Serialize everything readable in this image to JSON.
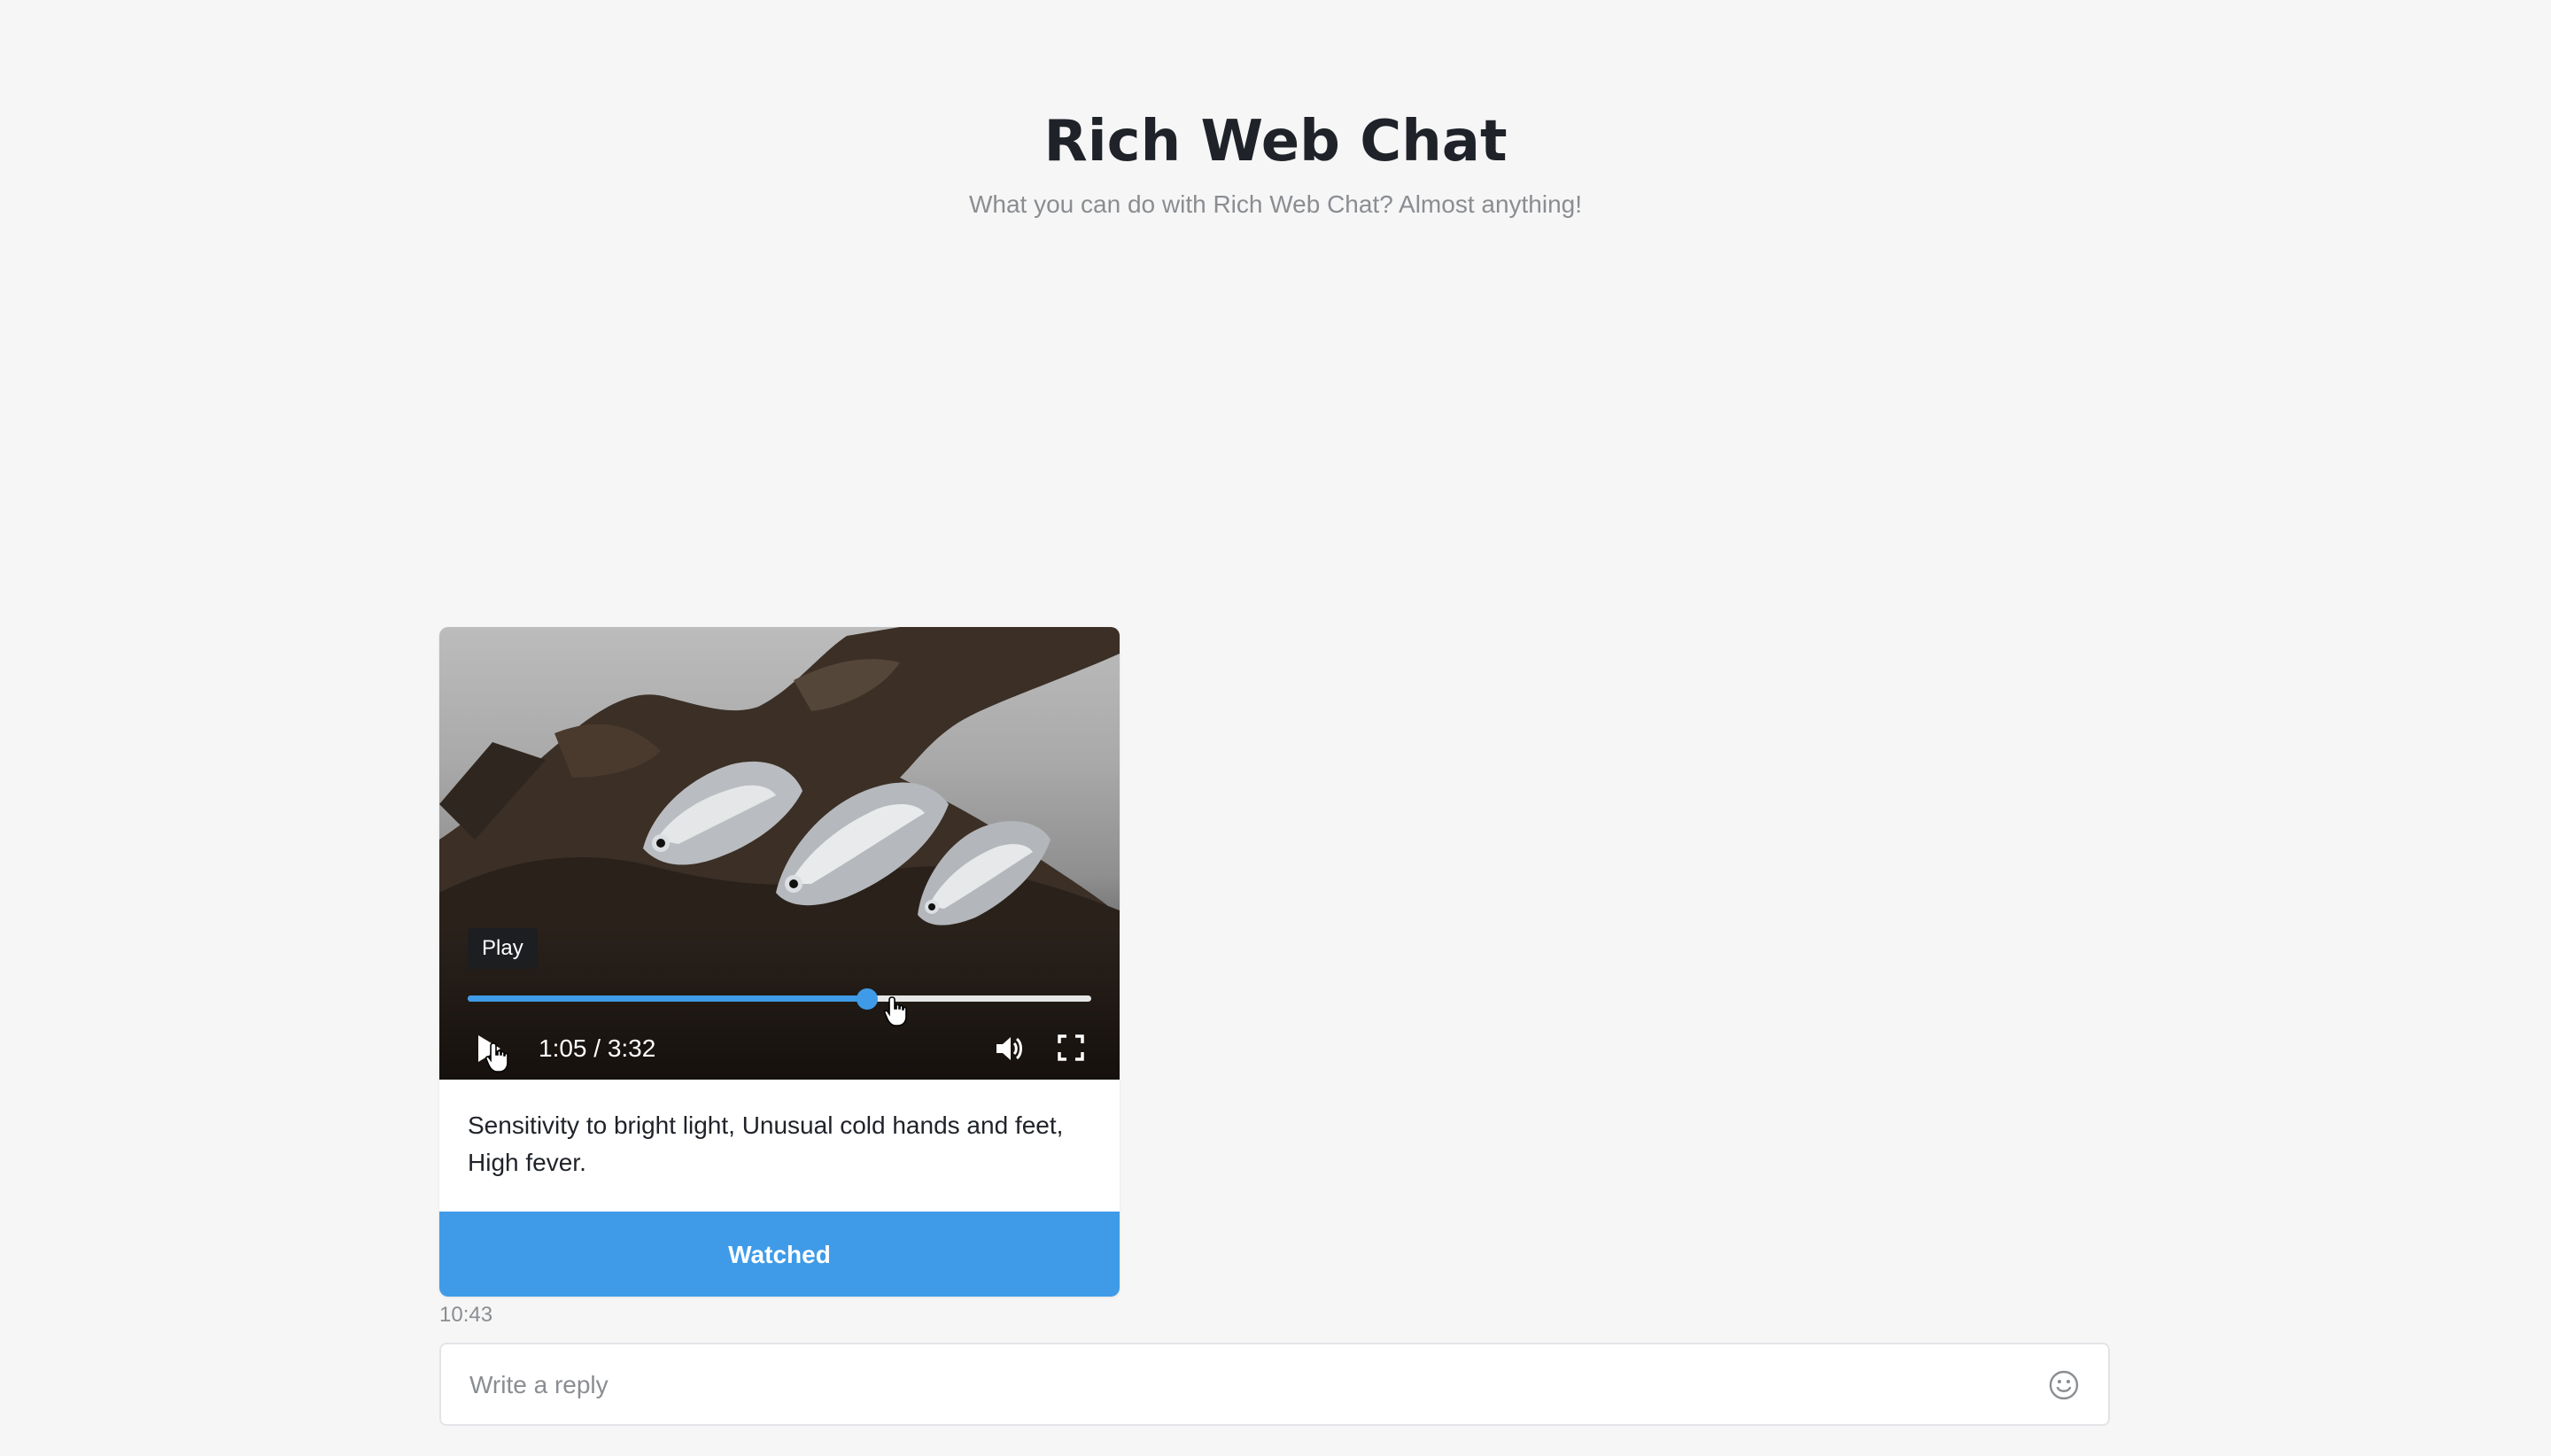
{
  "header": {
    "title": "Rich Web Chat",
    "subtitle": "What you can do with Rich Web Chat? Almost anything!"
  },
  "message": {
    "video": {
      "tooltip": "Play",
      "current_time": "1:05",
      "duration": "3:32",
      "time_display": "1:05 / 3:32",
      "progress_fraction": 0.64
    },
    "text": "Sensitivity to bright light, Unusual cold hands and feet, High fever.",
    "button_label": "Watched",
    "timestamp": "10:43"
  },
  "composer": {
    "placeholder": "Write a reply"
  },
  "colors": {
    "accent": "#3f9be8",
    "background": "#f6f6f6"
  },
  "icons": {
    "play": "play-icon",
    "volume": "volume-icon",
    "fullscreen": "fullscreen-icon",
    "emoji": "smiley-icon"
  }
}
